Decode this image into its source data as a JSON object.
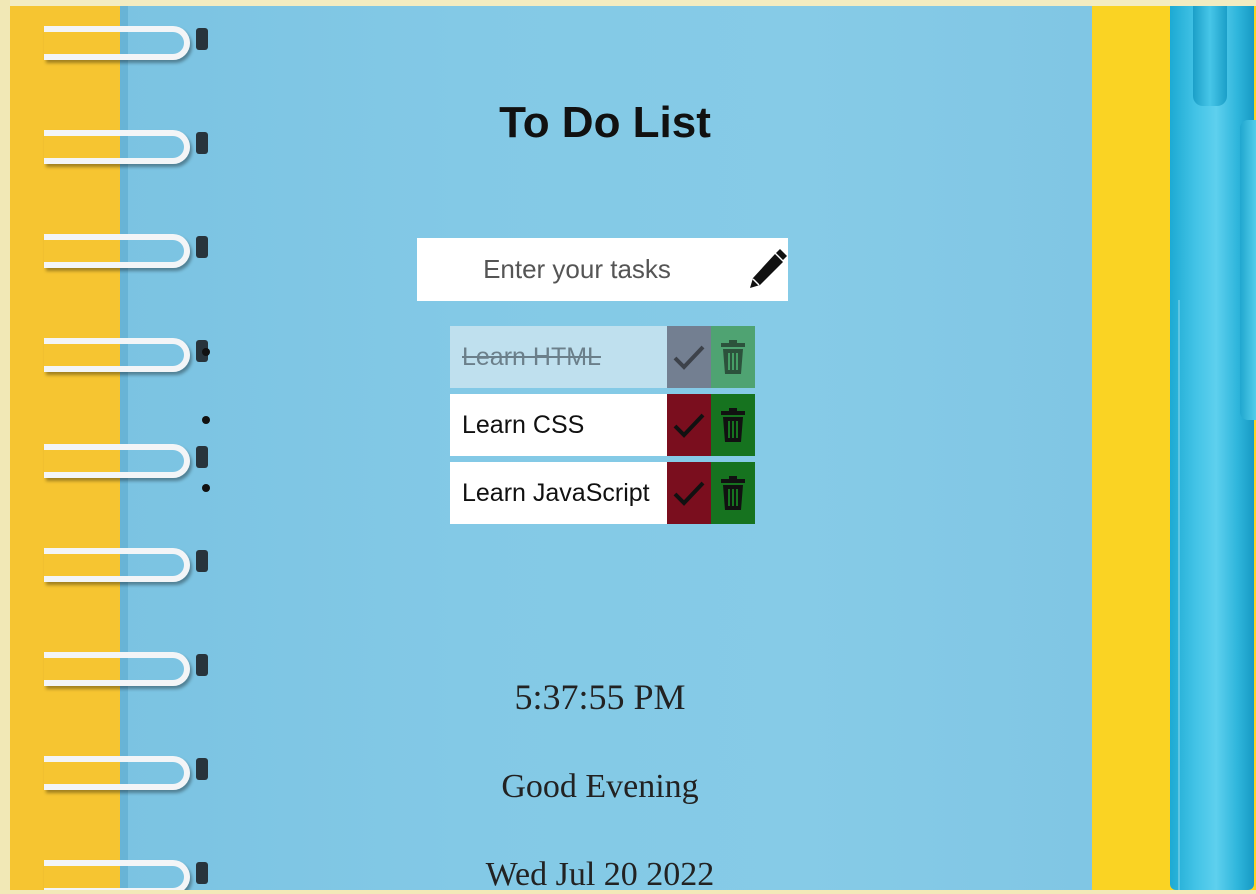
{
  "app": {
    "title": "To Do List"
  },
  "input": {
    "placeholder": "Enter your tasks",
    "value": ""
  },
  "tasks": [
    {
      "text": "Learn HTML",
      "done": true
    },
    {
      "text": "Learn CSS",
      "done": false
    },
    {
      "text": "Learn JavaScript",
      "done": false
    }
  ],
  "clock": {
    "time": "5:37:55 PM",
    "greeting": "Good Evening",
    "date": "Wed Jul 20 2022"
  },
  "icons": {
    "submit": "pencil-icon",
    "complete": "checkmark-icon",
    "delete": "trash-icon"
  },
  "colors": {
    "notebook": "#83c9e6",
    "complete_button": "#7a0e1e",
    "delete_button": "#16731f",
    "background_yellow": "#f6c531",
    "pen_blue": "#42c3e6"
  }
}
